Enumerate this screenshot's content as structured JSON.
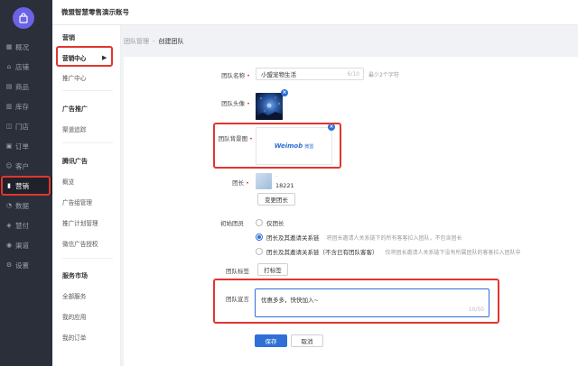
{
  "topbar": {
    "account_title": "微盟智慧零售演示账号"
  },
  "nav": {
    "items": [
      {
        "label": "概况",
        "icon": "chart-grid-icon"
      },
      {
        "label": "店铺",
        "icon": "store-icon"
      },
      {
        "label": "商品",
        "icon": "goods-icon"
      },
      {
        "label": "库存",
        "icon": "inventory-icon"
      },
      {
        "label": "门店",
        "icon": "shop-icon"
      },
      {
        "label": "订单",
        "icon": "order-icon"
      },
      {
        "label": "客户",
        "icon": "customer-icon"
      },
      {
        "label": "营销",
        "icon": "marketing-icon",
        "active": true
      },
      {
        "label": "数据",
        "icon": "data-icon"
      },
      {
        "label": "慧付",
        "icon": "pay-icon"
      },
      {
        "label": "渠道",
        "icon": "channel-icon"
      },
      {
        "label": "设置",
        "icon": "settings-icon"
      }
    ]
  },
  "submenu": {
    "sec1_head": "营销",
    "sec1_item1": "营销中心",
    "sec1_item2": "推广中心",
    "sec2_head": "广告推广",
    "sec2_item1": "渠道追踪",
    "sec3_head": "腾讯广告",
    "sec3_item1": "概览",
    "sec3_item2": "广告组管理",
    "sec3_item3": "推广计划管理",
    "sec3_item4": "微信广告授权",
    "sec4_head": "服务市场",
    "sec4_item1": "全部服务",
    "sec4_item2": "我的应用",
    "sec4_item3": "我的订单"
  },
  "breadcrumb": {
    "parent": "团队管理",
    "sep": "-",
    "current": "创建团队"
  },
  "form": {
    "name_label": "团队名称",
    "name_value": "小盟宠物生活",
    "name_count": "6/10",
    "name_hint": "最少2个字符",
    "avatar_label": "团队头像",
    "bg_label": "团队背景图",
    "bg_logo_text": "Weimob",
    "bg_logo_cn": "微盟",
    "leader_label": "团长",
    "leader_dot": "·",
    "leader_id": "18221",
    "change_leader_btn": "变更团长",
    "initial_members_label": "初始团员",
    "radio1": "仅团长",
    "radio2": "团长及其邀请关系链",
    "radio2_note": "将团长邀请人关系链下的所有客客拉入团队，不包含团长",
    "radio3": "团长及其邀请关系链（不含已有团队客客）",
    "radio3_note": "仅将团长邀请人关系链下没有所属团队的客客拉入团队中",
    "tag_label": "团队标签",
    "tag_btn": "打标签",
    "declaration_label": "团队宣言",
    "declaration_value": "优惠多多，快快加入~",
    "declaration_count": "10/50",
    "save_btn": "保存",
    "cancel_btn": "取消"
  },
  "colors": {
    "accent": "#2f6fd6",
    "highlight": "#e0362f",
    "nav_bg": "#2b2f3a"
  }
}
